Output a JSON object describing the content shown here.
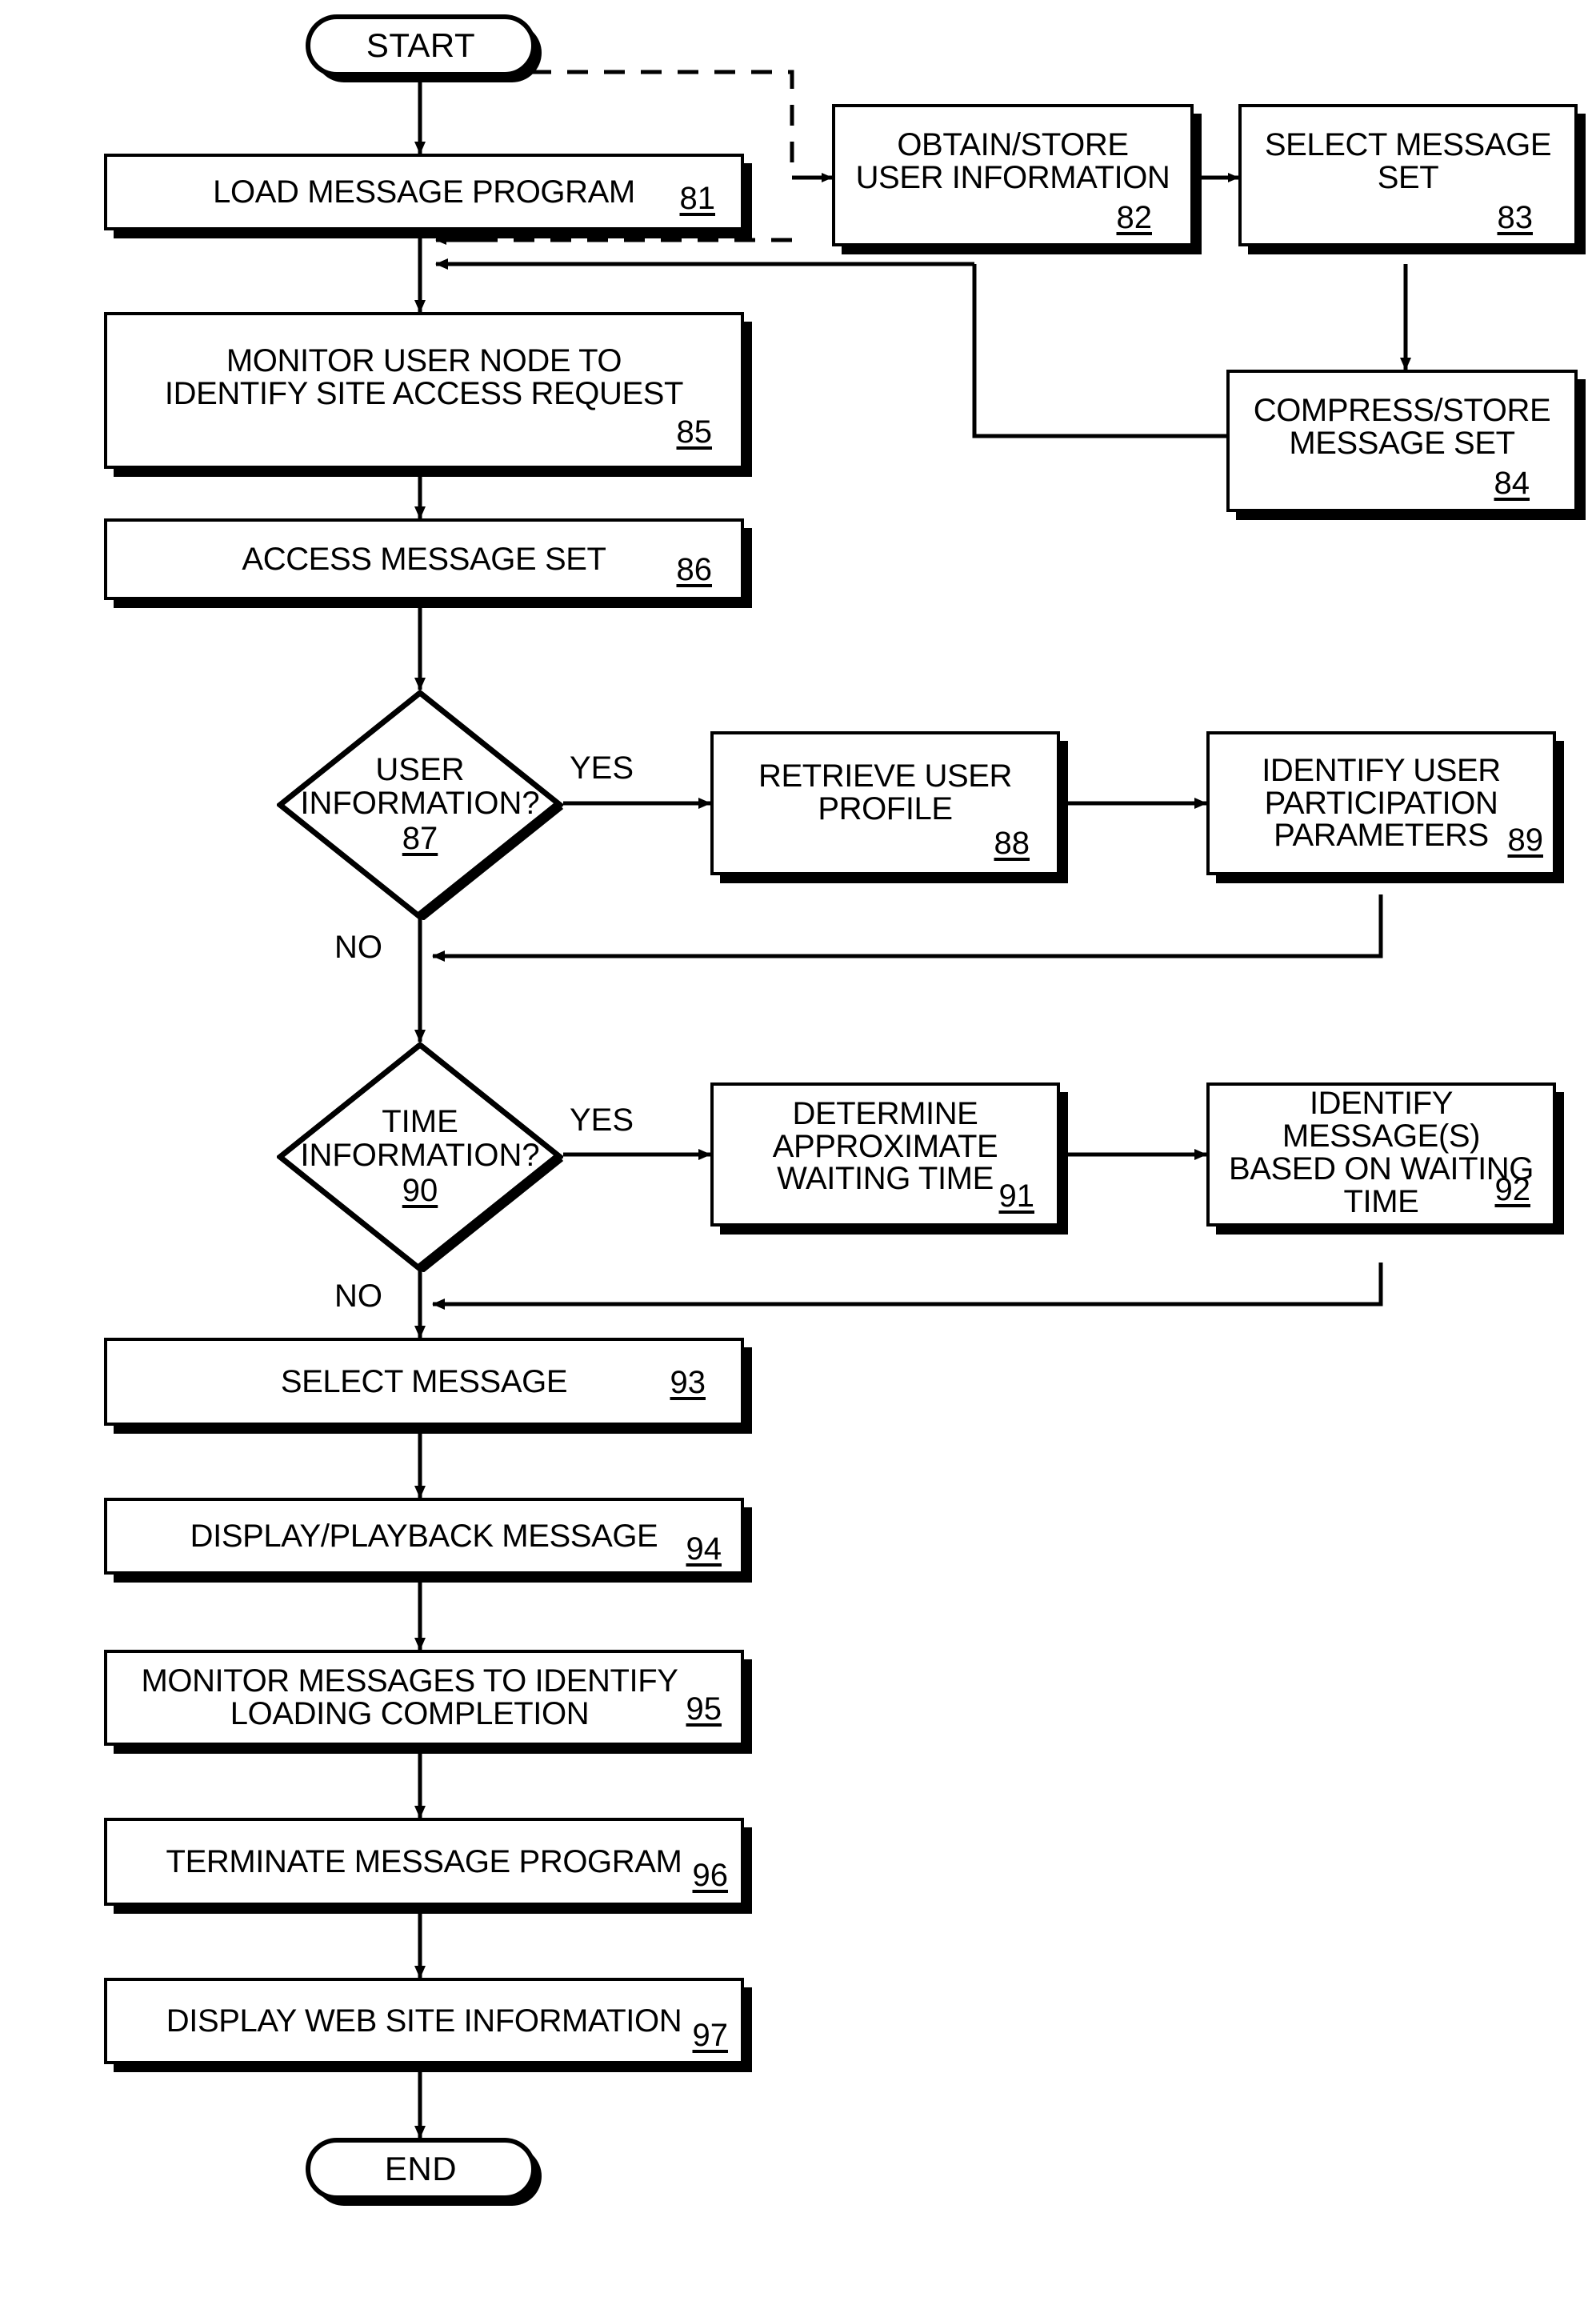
{
  "figure": {
    "type": "flowchart",
    "orientation": "portrait",
    "line_color": "#000000",
    "background": "#ffffff"
  },
  "terminators": {
    "start": "START",
    "end": "END"
  },
  "nodes": [
    {
      "id": "81",
      "ref": "81",
      "label": "LOAD MESSAGE PROGRAM"
    },
    {
      "id": "82",
      "ref": "82",
      "label": "OBTAIN/STORE\nUSER INFORMATION"
    },
    {
      "id": "83",
      "ref": "83",
      "label": "SELECT MESSAGE\nSET"
    },
    {
      "id": "84",
      "ref": "84",
      "label": "COMPRESS/STORE\nMESSAGE SET"
    },
    {
      "id": "85",
      "ref": "85",
      "label": "MONITOR USER NODE TO\nIDENTIFY SITE ACCESS REQUEST"
    },
    {
      "id": "86",
      "ref": "86",
      "label": "ACCESS MESSAGE SET"
    },
    {
      "id": "88",
      "ref": "88",
      "label": "RETRIEVE USER\nPROFILE"
    },
    {
      "id": "89",
      "ref": "89",
      "label": "IDENTIFY USER\nPARTICIPATION\nPARAMETERS"
    },
    {
      "id": "91",
      "ref": "91",
      "label": "DETERMINE\nAPPROXIMATE\nWAITING TIME"
    },
    {
      "id": "92",
      "ref": "92",
      "label": "IDENTIFY\nMESSAGE(S)\nBASED ON WAITING\nTIME"
    },
    {
      "id": "93",
      "ref": "93",
      "label": "SELECT MESSAGE"
    },
    {
      "id": "94",
      "ref": "94",
      "label": "DISPLAY/PLAYBACK MESSAGE"
    },
    {
      "id": "95",
      "ref": "95",
      "label": "MONITOR MESSAGES TO IDENTIFY\nLOADING COMPLETION"
    },
    {
      "id": "96",
      "ref": "96",
      "label": "TERMINATE MESSAGE PROGRAM"
    },
    {
      "id": "97",
      "ref": "97",
      "label": "DISPLAY WEB SITE INFORMATION"
    }
  ],
  "decisions": [
    {
      "id": "87",
      "ref": "87",
      "label": "USER\nINFORMATION?"
    },
    {
      "id": "90",
      "ref": "90",
      "label": "TIME\nINFORMATION?"
    }
  ],
  "edge_labels": {
    "yes_87": "YES",
    "no_87": "NO",
    "yes_90": "YES",
    "no_90": "NO"
  }
}
